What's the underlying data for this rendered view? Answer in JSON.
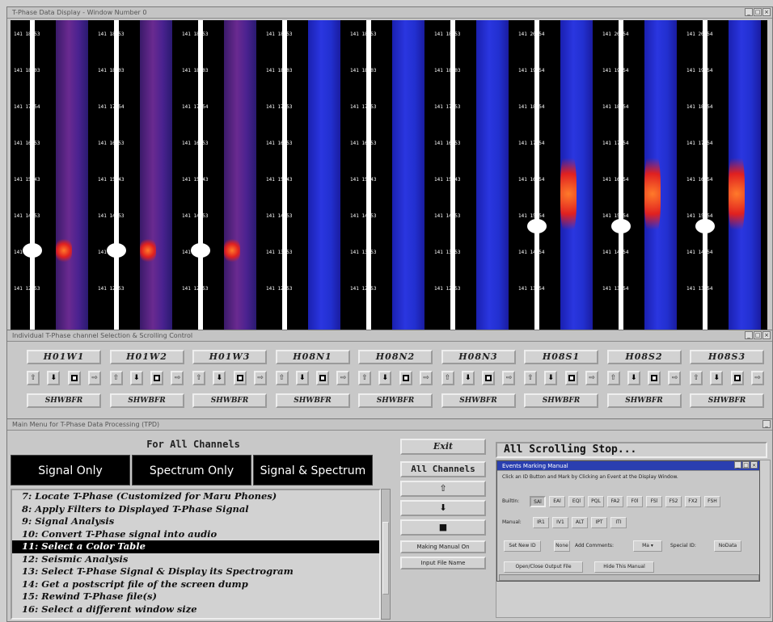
{
  "display_window": {
    "title": "T-Phase Data Display - Window Number 0",
    "controls": [
      "_",
      "□",
      "×"
    ],
    "channels": [
      {
        "ticks": [
          "141 18:53",
          "141 18:03",
          "141 17:54",
          "141 16:53",
          "141 15:43",
          "141 14:53",
          "141 13:53",
          "141 12:53"
        ]
      },
      {
        "ticks": [
          "141 18:53",
          "141 18:03",
          "141 17:54",
          "141 16:53",
          "141 15:43",
          "141 14:53",
          "141 13:53",
          "141 12:53"
        ]
      },
      {
        "ticks": [
          "141 18:53",
          "141 18:03",
          "141 17:54",
          "141 16:53",
          "141 15:43",
          "141 14:53",
          "141 13:53",
          "141 12:53"
        ]
      },
      {
        "ticks": [
          "141 18:53",
          "141 18:03",
          "141 17:53",
          "141 16:53",
          "141 15:43",
          "141 14:53",
          "141 13:53",
          "141 12:53"
        ]
      },
      {
        "ticks": [
          "141 18:53",
          "141 18:03",
          "141 17:53",
          "141 16:53",
          "141 15:43",
          "141 14:53",
          "141 13:53",
          "141 12:53"
        ]
      },
      {
        "ticks": [
          "141 18:53",
          "141 18:03",
          "141 17:53",
          "141 16:53",
          "141 15:43",
          "141 14:53",
          "141 13:53",
          "141 12:53"
        ]
      },
      {
        "ticks": [
          "141 20:54",
          "141 19:54",
          "141 18:54",
          "141 17:54",
          "141 16:54",
          "141 15:54",
          "141 14:54",
          "141 13:54"
        ]
      },
      {
        "ticks": [
          "141 20:54",
          "141 19:54",
          "141 18:54",
          "141 17:54",
          "141 16:54",
          "141 15:54",
          "141 14:54",
          "141 13:54"
        ]
      },
      {
        "ticks": [
          "141 20:54",
          "141 19:54",
          "141 18:54",
          "141 17:54",
          "141 16:54",
          "141 15:54",
          "141 14:54",
          "141 13:54"
        ]
      }
    ]
  },
  "channel_control": {
    "title": "Individual T-Phase channel Selection & Scrolling Control",
    "controls": [
      "_",
      "□",
      "×"
    ],
    "groups": [
      {
        "name": "H01W1",
        "shw": "SHWBFR"
      },
      {
        "name": "H01W2",
        "shw": "SHWBFR"
      },
      {
        "name": "H01W3",
        "shw": "SHWBFR"
      },
      {
        "name": "H08N1",
        "shw": "SHWBFR"
      },
      {
        "name": "H08N2",
        "shw": "SHWBFR"
      },
      {
        "name": "H08N3",
        "shw": "SHWBFR"
      },
      {
        "name": "H08S1",
        "shw": "SHWBFR"
      },
      {
        "name": "H08S2",
        "shw": "SHWBFR"
      },
      {
        "name": "H08S3",
        "shw": "SHWBFR"
      }
    ],
    "arrow_up": "⇧",
    "arrow_down": "⬇",
    "arrow_right": "⇨"
  },
  "main_window": {
    "title": "Main Menu for T-Phase Data Processing (TPD)",
    "controls": [
      "_"
    ],
    "for_all_channels": "For All Channels",
    "modes": [
      "Signal Only",
      "Spectrum Only",
      "Signal & Spectrum"
    ],
    "menu_items": [
      "7: Locate T-Phase (Customized for Maru Phones)",
      "8: Apply Filters to Displayed T-Phase Signal",
      "9: Signal Analysis",
      "10: Convert T-Phase signal into audio",
      "11: Select a Color Table",
      "12: Seismic Analysis",
      "13: Select T-Phase Signal & Display its Spectrogram",
      "14: Get a postscript file of the screen dump",
      "15: Rewind T-Phase file(s)",
      "16: Select a different window size"
    ],
    "selected_index": 4,
    "exit_label": "Exit",
    "all_channels_label": "All Channels",
    "arrow_up": "⇧",
    "arrow_down": "⬇",
    "stop_symbol": "■",
    "making_manual_label": "Making Manual On",
    "input_file_label": "Input File Name",
    "status_text": "All Scrolling Stop..."
  },
  "event_dialog": {
    "title": "Events Marking Manual",
    "controls": [
      "_",
      "□",
      "×"
    ],
    "instructions": "Click an ID Button and Mark by Clicking an Event at the Display Window.",
    "built_in_label": "BuiltIn:",
    "built_in_ids": [
      "SAl",
      "EAl",
      "EQl",
      "PQL",
      "FA2",
      "F0l",
      "FSl",
      "FS2",
      "FX2",
      "FSH"
    ],
    "manual_label": "Manual:",
    "manual_ids": [
      "IR1",
      "IV1",
      "ALT",
      "IPT",
      "ITI"
    ],
    "set_new_id": "Set New ID",
    "none_btn": "None",
    "add_comment_label": "Add Comments:",
    "add_comment_value": "Ma",
    "special_id_label": "Special ID:",
    "special_id_value": "NoData",
    "open_close_output": "Open/Close Output File",
    "hide_manual": "Hide This Manual"
  },
  "colors": {
    "spectrum_blue": "#1f2bd8",
    "spectrum_purple": "#5a2aa0",
    "hot": "#ff5a20",
    "title_blue": "#2a3fb0"
  }
}
